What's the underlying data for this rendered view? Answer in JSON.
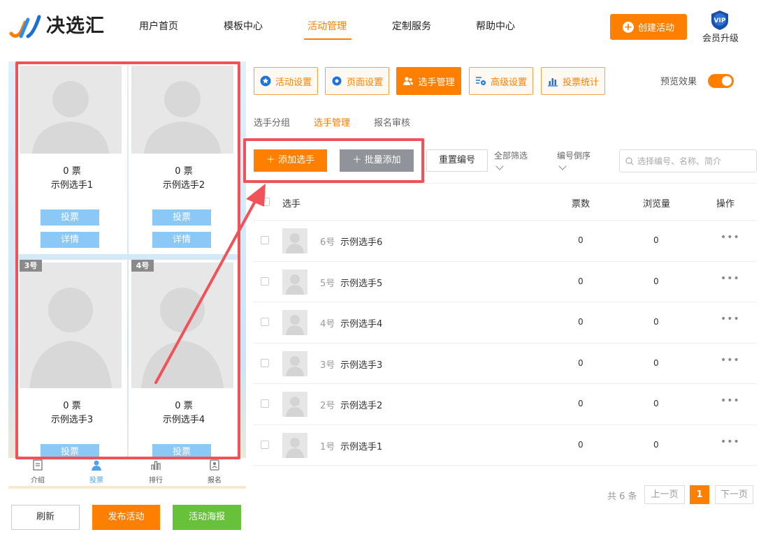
{
  "header": {
    "logo_text": "决选汇",
    "nav": [
      {
        "label": "用户首页"
      },
      {
        "label": "模板中心"
      },
      {
        "label": "活动管理"
      },
      {
        "label": "定制服务"
      },
      {
        "label": "帮助中心"
      }
    ],
    "create_label": "创建活动",
    "vip_badge": "VIP",
    "vip_label": "会员升级"
  },
  "preview": {
    "cards": [
      {
        "votes": "0 票",
        "name": "示例选手1",
        "vote_btn": "投票",
        "detail_btn": "详情"
      },
      {
        "votes": "0 票",
        "name": "示例选手2",
        "vote_btn": "投票",
        "detail_btn": "详情"
      },
      {
        "tag": "3号",
        "votes": "0 票",
        "name": "示例选手3",
        "vote_btn": "投票"
      },
      {
        "tag": "4号",
        "votes": "0 票",
        "name": "示例选手4",
        "vote_btn": "投票"
      }
    ],
    "bottom_nav": [
      {
        "label": "介绍"
      },
      {
        "label": "投票"
      },
      {
        "label": "排行"
      },
      {
        "label": "报名"
      }
    ]
  },
  "actions": {
    "refresh": "刷新",
    "publish": "发布活动",
    "poster": "活动海报"
  },
  "tabs": [
    {
      "label": "活动设置"
    },
    {
      "label": "页面设置"
    },
    {
      "label": "选手管理"
    },
    {
      "label": "高级设置"
    },
    {
      "label": "投票统计"
    }
  ],
  "preview_toggle_label": "预览效果",
  "subtabs": [
    {
      "label": "选手分组"
    },
    {
      "label": "选手管理"
    },
    {
      "label": "报名审核"
    }
  ],
  "toolbar": {
    "add": "添加选手",
    "batch": "批量添加",
    "renumber": "重置编号",
    "filter": "全部筛选",
    "sort": "编号倒序",
    "search_placeholder": "选择编号、名称、简介"
  },
  "table": {
    "headers": {
      "player": "选手",
      "votes": "票数",
      "views": "浏览量",
      "ops": "操作"
    },
    "rows": [
      {
        "num": "6号",
        "name": "示例选手6",
        "votes": "0",
        "views": "0"
      },
      {
        "num": "5号",
        "name": "示例选手5",
        "votes": "0",
        "views": "0"
      },
      {
        "num": "4号",
        "name": "示例选手4",
        "votes": "0",
        "views": "0"
      },
      {
        "num": "3号",
        "name": "示例选手3",
        "votes": "0",
        "views": "0"
      },
      {
        "num": "2号",
        "name": "示例选手2",
        "votes": "0",
        "views": "0"
      },
      {
        "num": "1号",
        "name": "示例选手1",
        "votes": "0",
        "views": "0"
      }
    ],
    "more_glyph": "•••"
  },
  "pagination": {
    "total": "共 6 条",
    "prev": "上一页",
    "current": "1",
    "next": "下一页"
  },
  "colors": {
    "accent": "#ff8000",
    "highlight": "#f0525a",
    "vote_btn": "#8cc8f6",
    "poster": "#67c23a"
  }
}
